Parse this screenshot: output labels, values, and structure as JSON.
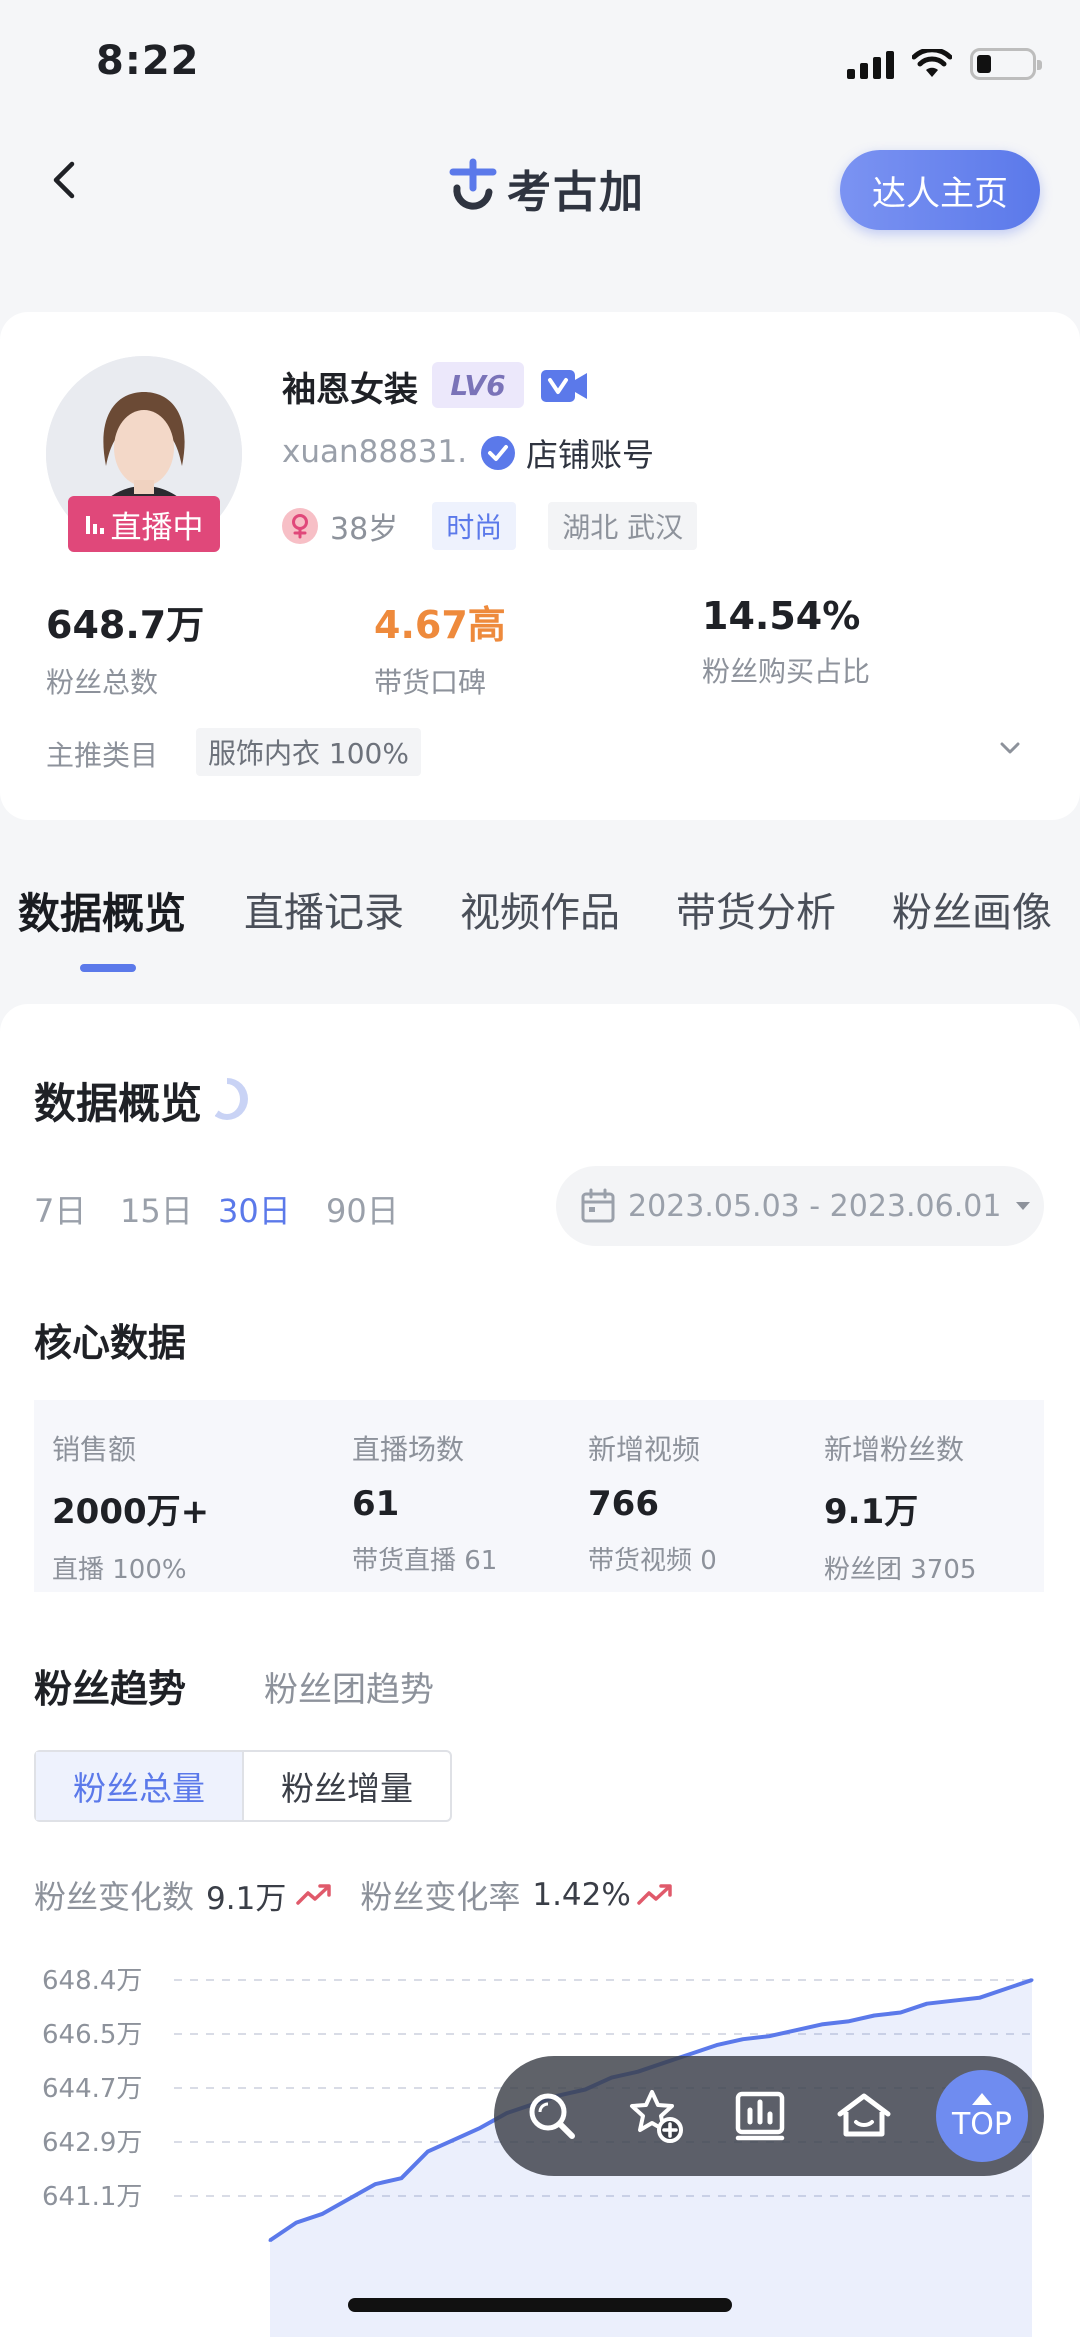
{
  "status_bar": {
    "time": "8:22"
  },
  "header": {
    "logo_text": "考古加",
    "daren_button": "达人主页"
  },
  "profile": {
    "name": "袖恩女装",
    "level": "LV6",
    "uid": "xuan88831.",
    "verified_label": "店铺账号",
    "live_badge": "直播中",
    "age": "38岁",
    "tag_category": "时尚",
    "tag_location": "湖北 武汉",
    "stats": [
      {
        "value": "648.7万",
        "label": "粉丝总数"
      },
      {
        "value": "4.67高",
        "label": "带货口碑"
      },
      {
        "value": "14.54%",
        "label": "粉丝购买占比"
      }
    ],
    "main_category_label": "主推类目",
    "main_category_value": "服饰内衣 100%"
  },
  "tabs": [
    "数据概览",
    "直播记录",
    "视频作品",
    "带货分析",
    "粉丝画像"
  ],
  "overview": {
    "title": "数据概览",
    "ranges": [
      "7日",
      "15日",
      "30日",
      "90日"
    ],
    "active_range": "30日",
    "date_range": "2023.05.03 - 2023.06.01"
  },
  "core": {
    "title": "核心数据",
    "items": [
      {
        "label": "销售额",
        "value": "2000万+",
        "sub": "直播 100%"
      },
      {
        "label": "直播场数",
        "value": "61",
        "sub": "带货直播 61"
      },
      {
        "label": "新增视频",
        "value": "766",
        "sub": "带货视频 0"
      },
      {
        "label": "新增粉丝数",
        "value": "9.1万",
        "sub": "粉丝团 3705"
      }
    ]
  },
  "fans": {
    "tab_active": "粉丝趋势",
    "tab_other": "粉丝团趋势",
    "seg_active": "粉丝总量",
    "seg_other": "粉丝增量",
    "change_label": "粉丝变化数",
    "change_value": "9.1万",
    "rate_label": "粉丝变化率",
    "rate_value": "1.42%",
    "accent_up": "#e05a6b"
  },
  "chart_data": {
    "type": "area",
    "y_tick_labels": [
      "648.4万",
      "646.5万",
      "644.7万",
      "642.9万",
      "641.1万"
    ],
    "ylim": [
      640.0,
      648.6
    ],
    "grid": true,
    "series": [
      {
        "values": [
          639.6,
          640.2,
          640.5,
          641.0,
          641.5,
          641.7,
          642.6,
          643.0,
          643.4,
          643.9,
          644.2,
          644.5,
          644.7,
          645.1,
          645.3,
          645.6,
          645.9,
          646.2,
          646.4,
          646.5,
          646.7,
          646.9,
          647.0,
          647.2,
          647.3,
          647.6,
          647.7,
          647.8,
          648.1,
          648.4
        ]
      }
    ],
    "color": "#5b79ea"
  },
  "toolbar": {
    "icons": [
      "search-icon",
      "favorite-add-icon",
      "chart-icon",
      "home-icon"
    ],
    "top_label": "TOP"
  }
}
